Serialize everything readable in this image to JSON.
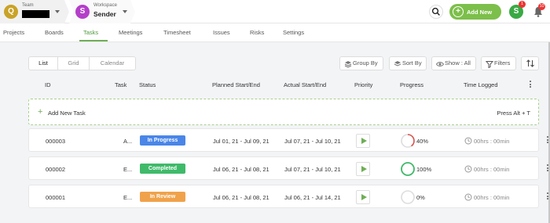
{
  "header": {
    "team": {
      "initial": "Q",
      "caption": "Team"
    },
    "workspace": {
      "initial": "S",
      "caption": "Workspace",
      "name": "Sender"
    },
    "add_new_label": "Add New",
    "user_initial": "S",
    "user_badge": "1",
    "notification_badge": "10"
  },
  "nav": {
    "tabs": [
      {
        "label": "Projects",
        "active": false
      },
      {
        "label": "Boards",
        "active": false
      },
      {
        "label": "Tasks",
        "active": true
      },
      {
        "label": "Meetings",
        "active": false
      },
      {
        "label": "Timesheet",
        "active": false
      },
      {
        "label": "Issues",
        "active": false
      },
      {
        "label": "Risks",
        "active": false
      },
      {
        "label": "Settings",
        "active": false
      }
    ]
  },
  "toolbar": {
    "views": [
      "List",
      "Grid",
      "Calendar"
    ],
    "active_view": "List",
    "group_by": "Group By",
    "sort_by": "Sort By",
    "show": "Show : All",
    "filters": "Filters"
  },
  "table": {
    "columns": [
      "ID",
      "Task",
      "Status",
      "Planned Start/End",
      "Actual Start/End",
      "Priority",
      "Progress",
      "Time Logged"
    ],
    "add_task_label": "Add New Task",
    "add_task_hint": "Press Alt + T",
    "rows": [
      {
        "id": "000003",
        "task": "A...",
        "status": "In Progress",
        "status_color": "#4a86e8",
        "planned": "Jul 01, 21 - Jul 09, 21",
        "actual": "Jul 07, 21 - Jul 10, 21",
        "progress_label": "40%",
        "progress": 0.4,
        "progress_color": "#d9534f",
        "time_logged": "00hrs : 00min"
      },
      {
        "id": "000002",
        "task": "E...",
        "status": "Completed",
        "status_color": "#3fba6a",
        "planned": "Jul 06, 21 - Jul 08, 21",
        "actual": "Jul 07, 21 - Jul 10, 21",
        "progress_label": "100%",
        "progress": 1.0,
        "progress_color": "#3fba6a",
        "time_logged": "00hrs : 00min"
      },
      {
        "id": "000001",
        "task": "E...",
        "status": "In Review",
        "status_color": "#f0a24a",
        "planned": "Jul 06, 21 - Jul 08, 21",
        "actual": "Jul 06, 21 - Jul 14, 21",
        "progress_label": "0%",
        "progress": 0,
        "progress_color": "#cccccc",
        "time_logged": "00hrs : 00min"
      }
    ]
  },
  "colors": {
    "brand_green": "#7cbf4a",
    "active_tab": "#4c9a3c"
  }
}
